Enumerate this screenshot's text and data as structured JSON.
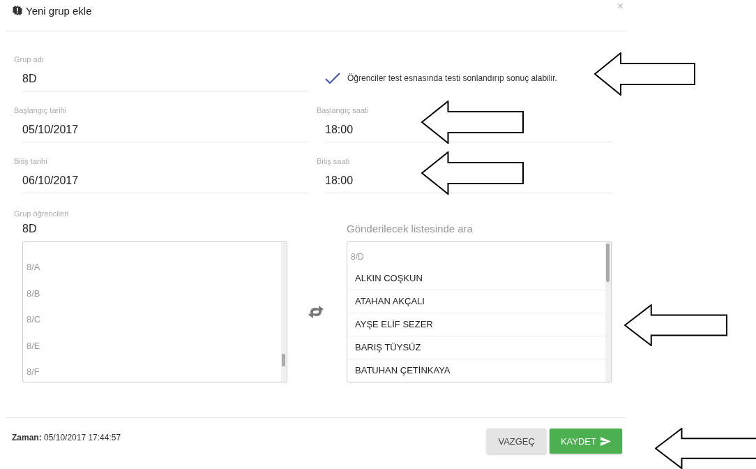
{
  "dialog": {
    "title": "Yeni grup ekle",
    "close": "×"
  },
  "fields": [
    {
      "label": "Grup adı",
      "value": "8D",
      "kind": "text"
    },
    {
      "kind": "checkbox",
      "label": "Öğrenciler test esnasında testi sonlandırıp sonuç alabilir.",
      "checked": true
    },
    {
      "label": "Başlangıç tarihi",
      "value": "05/10/2017",
      "kind": "text"
    },
    {
      "label": "Başlangıç saati",
      "value": "18:00",
      "kind": "text"
    },
    {
      "label": "Bitiş tarihi",
      "value": "06/10/2017",
      "kind": "text"
    },
    {
      "label": "Bitiş saati",
      "value": "18:00",
      "kind": "text"
    }
  ],
  "students": {
    "label": "Grup öğrencileri",
    "value": "8D",
    "groups": [
      "8/A",
      "8/B",
      "8/C",
      "8/E",
      "8/F"
    ]
  },
  "recipients": {
    "placeholder": "Gönderilecek listesinde ara",
    "group": "8/D",
    "names": [
      "ALKIN COŞKUN",
      "ATAHAN AKÇALI",
      "AYŞE ELİF SEZER",
      "BARIŞ TÜYSÜZ",
      "BATUHAN ÇETİNKAYA"
    ]
  },
  "footer": {
    "time_label": "Zaman:",
    "time": "05/10/2017 17:44:57",
    "buttons": [
      {
        "label": "VAZGEÇ",
        "kind": "secondary"
      },
      {
        "label": "KAYDET",
        "kind": "primary"
      }
    ]
  }
}
